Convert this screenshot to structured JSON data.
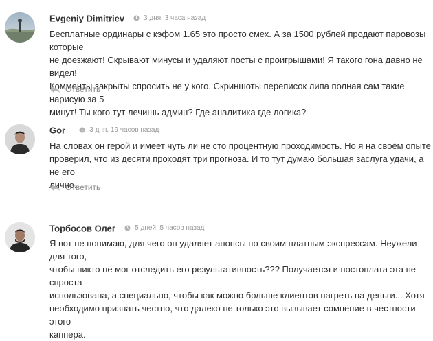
{
  "comments": [
    {
      "author": "Evgeniy Dimitriev",
      "time": "3 дня, 3 часа назад",
      "lines": [
        "Бесплатные ординары с кэфом 1.65 это просто смех. А за 1500 рублей продают паровозы которые",
        "не доезжают! Скрывают минусы и удаляют посты с проигрышами! Я такого гона давно не видел!",
        "Комменты закрыты спросить не у кого. Скриншоты переписок липа полная сам такие нарисую за 5",
        "минут! Ты кого тут лечишь админ? Где аналитика где логика?"
      ],
      "reply_label": "Ответить"
    },
    {
      "author": "Gor_",
      "time": "3 дня, 19 часов назад",
      "lines": [
        "На словах он герой и имеет чуть ли не сто процентную проходимость. Но я на своём опыте",
        "проверил, что из десяти проходят три прогноза. И то тут думаю большая заслуга удачи, а не его",
        "лично."
      ],
      "reply_label": "Ответить"
    },
    {
      "author": "Торбосов Олег",
      "time": "5 дней, 5 часов назад",
      "lines": [
        "Я вот не понимаю, для чего он удаляет анонсы по своим платным экспрессам. Неужели для того,",
        "чтобы никто не мог отследить его результативность??? Получается и постоплата эта не спроста",
        "использована, а специально, чтобы как можно больше клиентов нагреть на деньги... Хотя",
        "необходимо признать честно, что далеко не только это вызывает сомнение в честности этого",
        "каппера."
      ]
    }
  ]
}
